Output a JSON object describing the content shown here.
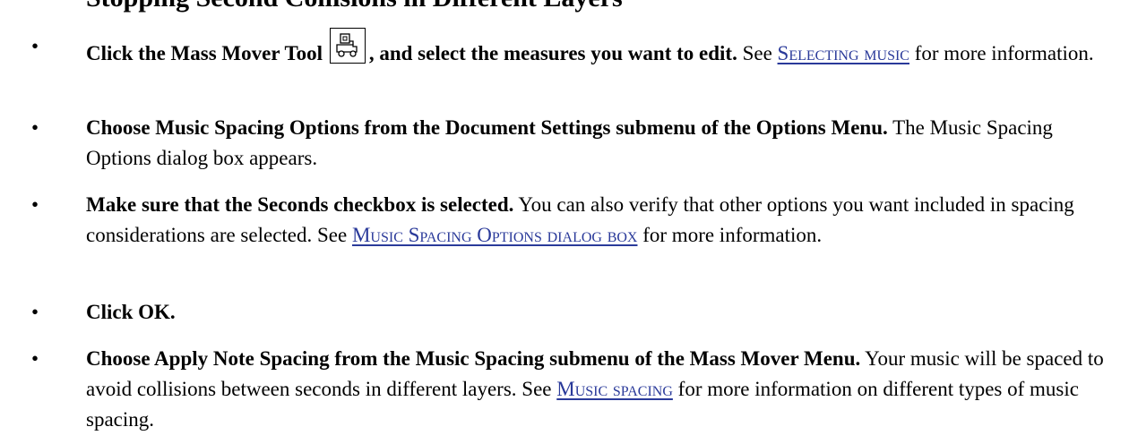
{
  "heading": "Stopping Second Collisions in Different Layers",
  "colors": {
    "link": "#2a3a9a",
    "text": "#000000"
  },
  "steps": [
    {
      "lead_a": "Click the Mass Mover Tool",
      "icon": "mass-mover-tool-icon",
      "lead_b": ", and select the measures you want to edit.",
      "text_a": " See ",
      "link": "Selecting music",
      "text_b": " for more information."
    },
    {
      "lead": "Choose Music Spacing Options from the Document Settings submenu of the Options Menu.",
      "text": " The Music Spacing Options dialog box appears."
    },
    {
      "lead": "Make sure that the Seconds checkbox is selected.",
      "text_a": " You can also verify that other options you want included in spacing considerations are selected. See ",
      "link": "Music Spacing Options dialog box",
      "text_b": " for more information."
    },
    {
      "lead": "Click OK."
    },
    {
      "lead": "Choose Apply Note Spacing from the Music Spacing submenu of the Mass Mover Menu.",
      "text_a": " Your music will be spaced to avoid collisions between seconds in different layers. See ",
      "link": "Music spacing",
      "text_b": " for more information on different types of music spacing."
    }
  ]
}
